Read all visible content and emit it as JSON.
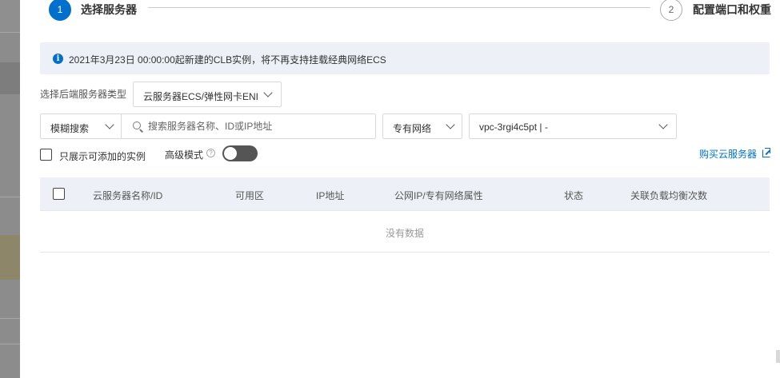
{
  "steps": [
    {
      "number": "1",
      "label": "选择服务器"
    },
    {
      "number": "2",
      "label": "配置端口和权重"
    }
  ],
  "notice": {
    "icon": "info-icon",
    "text": "2021年3月23日 00:00:00起新建的CLB实例，将不再支持挂载经典网络ECS"
  },
  "server_type": {
    "label": "选择后端服务器类型",
    "selected": "云服务器ECS/弹性网卡ENI"
  },
  "search": {
    "mode": "模糊搜索",
    "placeholder": "搜索服务器名称、ID或IP地址",
    "value": ""
  },
  "network": {
    "type": "专有网络",
    "vpc": "vpc-3rgi4c5pt | -"
  },
  "options": {
    "only_addable_label": "只展示可添加的实例",
    "only_addable_checked": false,
    "advanced_label": "高级模式",
    "advanced_on": false,
    "buy_link": "购买云服务器"
  },
  "table": {
    "columns": [
      "云服务器名称/ID",
      "可用区",
      "IP地址",
      "公网IP/专有网络属性",
      "状态",
      "关联负载均衡次数"
    ],
    "empty_text": "没有数据"
  },
  "colors": {
    "accent": "#0070cc",
    "notice_bg": "#edf1f7",
    "toggle_off": "#555555"
  }
}
